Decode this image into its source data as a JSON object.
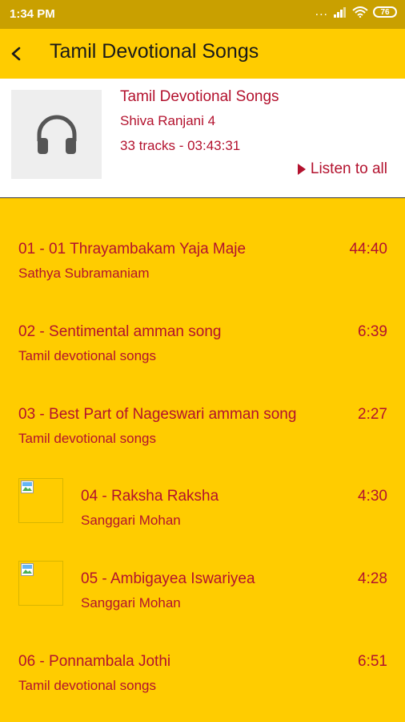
{
  "status": {
    "time": "1:34 PM",
    "dots": "...",
    "battery": "76"
  },
  "app_bar": {
    "title": "Tamil Devotional Songs"
  },
  "album": {
    "title": "Tamil Devotional Songs",
    "artist": "Shiva Ranjani 4",
    "meta": "33 tracks - 03:43:31",
    "listen_label": "Listen to all"
  },
  "tracks": [
    {
      "title": "01 - 01 Thrayambakam Yaja Maje",
      "artist": "Sathya Subramaniam",
      "duration": "44:40",
      "thumb": false
    },
    {
      "title": "02 - Sentimental amman song",
      "artist": "Tamil devotional songs",
      "duration": "6:39",
      "thumb": false
    },
    {
      "title": "03 - Best Part of Nageswari amman song",
      "artist": "Tamil devotional songs",
      "duration": "2:27",
      "thumb": false
    },
    {
      "title": "04 - Raksha Raksha",
      "artist": "Sanggari Mohan",
      "duration": "4:30",
      "thumb": true
    },
    {
      "title": "05 - Ambigayea Iswariyea",
      "artist": "Sanggari Mohan",
      "duration": "4:28",
      "thumb": true
    },
    {
      "title": "06 - Ponnambala Jothi",
      "artist": "Tamil devotional songs",
      "duration": "6:51",
      "thumb": false
    }
  ],
  "colors": {
    "accent": "#FFCC00",
    "text_red": "#B3122E",
    "status_bar": "#C9A000"
  }
}
